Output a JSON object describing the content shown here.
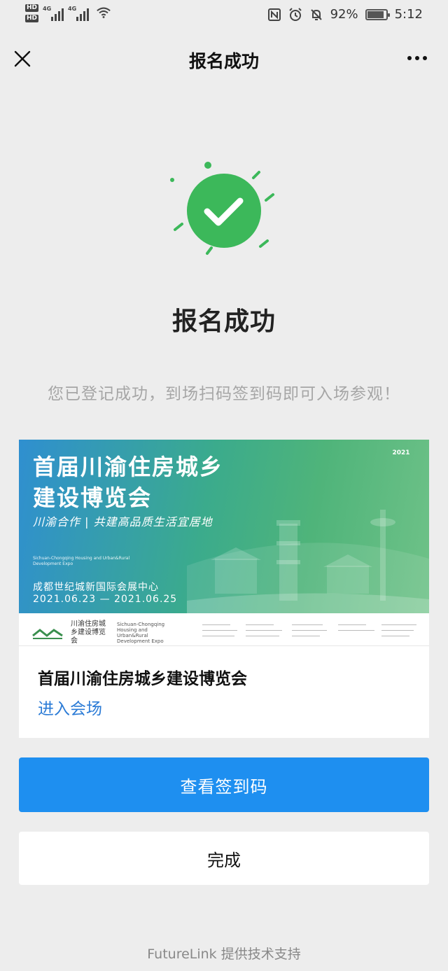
{
  "status_bar": {
    "hd1": "HD",
    "hd2": "HD",
    "net1": "4G",
    "net2": "4G",
    "battery_text": "92%",
    "battery_level": 0.92,
    "time": "5:12",
    "icons": [
      "nfc-icon",
      "alarm-icon",
      "mute-icon"
    ]
  },
  "nav": {
    "title": "报名成功",
    "close_icon": "close-icon",
    "more_icon": "more-icon"
  },
  "success": {
    "icon": "check-circle-icon",
    "accent": "#3cb85a",
    "heading": "报名成功",
    "message": "您已登记成功，到场扫码签到码即可入场参观！"
  },
  "event_card": {
    "banner": {
      "title_line1": "首届川渝住房城乡",
      "title_line2": "建设博览会",
      "slogan": "川渝合作 | 共建高品质生活宜居地",
      "english": "Sichuan-Chongqing Housing and Urban&Rural Development Expo",
      "venue": "成都世纪城新国际会展中心",
      "dates": "2021.06.23 — 2021.06.25",
      "year_badge": "2021",
      "logo_cn": "川渝住房城乡建设博览会",
      "logo_en": "Sichuan-Chongqing Housing and Urban&Rural Development Expo"
    },
    "title": "首届川渝住房城乡建设博览会",
    "link": "进入会场"
  },
  "buttons": {
    "view_code": "查看签到码",
    "done": "完成"
  },
  "footer": "FutureLink 提供技术支持",
  "colors": {
    "primary": "#1e8ff0",
    "link": "#2b7bd6",
    "background": "#ededed"
  }
}
